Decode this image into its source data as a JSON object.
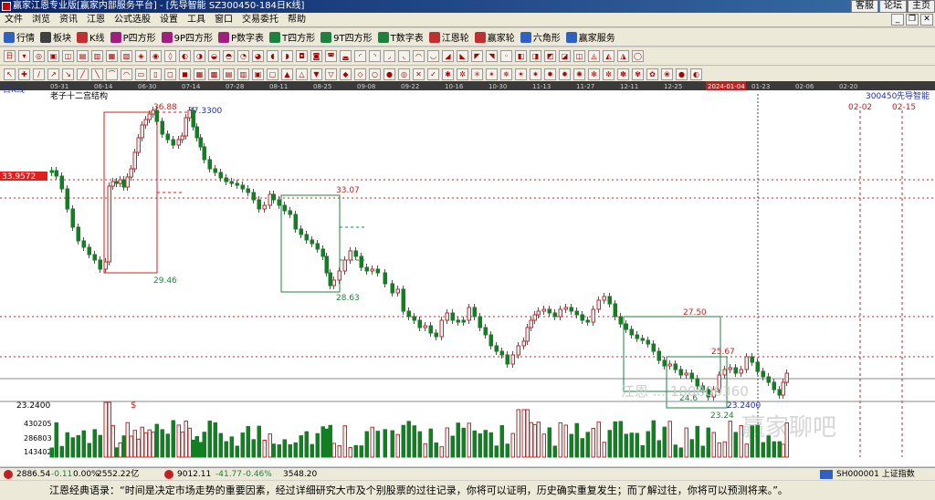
{
  "window": {
    "title": "赢家江恩专业版[赢家内部服务平台] - [先导智能  SZ300450-184日K线]",
    "links": [
      "客服",
      "论坛",
      "主页"
    ]
  },
  "menu": [
    "文件",
    "浏览",
    "资讯",
    "江恩",
    "公式选股",
    "设置",
    "工具",
    "窗口",
    "交易委托",
    "帮助"
  ],
  "toolbar": [
    {
      "label": "行情",
      "icon": "grid-icon",
      "color": "#3060c0"
    },
    {
      "label": "板块",
      "icon": "blocks-icon",
      "color": "#404040"
    },
    {
      "label": "K线",
      "icon": "candle-icon",
      "color": "#c03030"
    },
    {
      "label": "P四方形",
      "icon": "p-square-icon",
      "color": "#a02080"
    },
    {
      "label": "9P四方形",
      "icon": "9p-square-icon",
      "color": "#a02080"
    },
    {
      "label": "P数字表",
      "icon": "p-table-icon",
      "color": "#a02080"
    },
    {
      "label": "T四方形",
      "icon": "t-square-icon",
      "color": "#208040"
    },
    {
      "label": "9T四方形",
      "icon": "9t-square-icon",
      "color": "#208040"
    },
    {
      "label": "T数字表",
      "icon": "t-table-icon",
      "color": "#208040"
    },
    {
      "label": "江恩轮",
      "icon": "gann-wheel-icon",
      "color": "#c03030"
    },
    {
      "label": "赢家轮",
      "icon": "winner-wheel-icon",
      "color": "#c03030"
    },
    {
      "label": "六角形",
      "icon": "hexagon-icon",
      "color": "#3060c0"
    },
    {
      "label": "赢家服务",
      "icon": "service-icon",
      "color": "#3060c0"
    }
  ],
  "chart": {
    "period_label": "日K线",
    "study_label": "老子十二宫结构",
    "code_label": "300450",
    "name_label": "先导智能",
    "last_price_tag": "33.9572",
    "vol_max_label": "23.2400",
    "date_axis": [
      "05-31",
      "06-14",
      "06-30",
      "07-14",
      "07-28",
      "08-11",
      "08-25",
      "09-08",
      "09-22",
      "10-16",
      "10-30",
      "11-13",
      "11-27",
      "12-11",
      "12-25",
      "2024-01-04",
      "01-23",
      "02-06",
      "02-20"
    ],
    "future_dates": [
      "02-02",
      "02-15"
    ],
    "annotations": {
      "h1": "36.88",
      "h2": "37.3300",
      "l1": "29.46",
      "h3": "33.07",
      "l2": "28.63",
      "h4": "27.50",
      "h5": "25.67",
      "l3": "24.6",
      "l4": "23.24",
      "l5": "23.2400"
    },
    "volume_ticks": [
      "430205",
      "286803",
      "143402"
    ],
    "volume_marker": "$",
    "watermark": "江恩 ... 100800360",
    "watermark2": "赢家聊吧"
  },
  "status": {
    "sh_index": "2886.54",
    "sh_change": "-0.11",
    "sh_pct": "0.00%",
    "sh_amount": "2552.22亿",
    "sz_index": "9012.11",
    "sz_change": "-41.77",
    "sz_pct": "-0.46%",
    "sz_amount": "3548.20",
    "index_code": "SH000001 上证指数"
  },
  "quote": "江恩经典语录：“时间是决定市场走势的重要因素，经过详细研究大市及个别股票的过往记录，你将可以证明，历史确实重复发生；而了解过往，你将可以预测将来。”。",
  "colors": {
    "up": "#d42020",
    "down": "#108020",
    "annotation_red": "#c02020",
    "annotation_green": "#208040",
    "annotation_blue": "#2030a0"
  }
}
